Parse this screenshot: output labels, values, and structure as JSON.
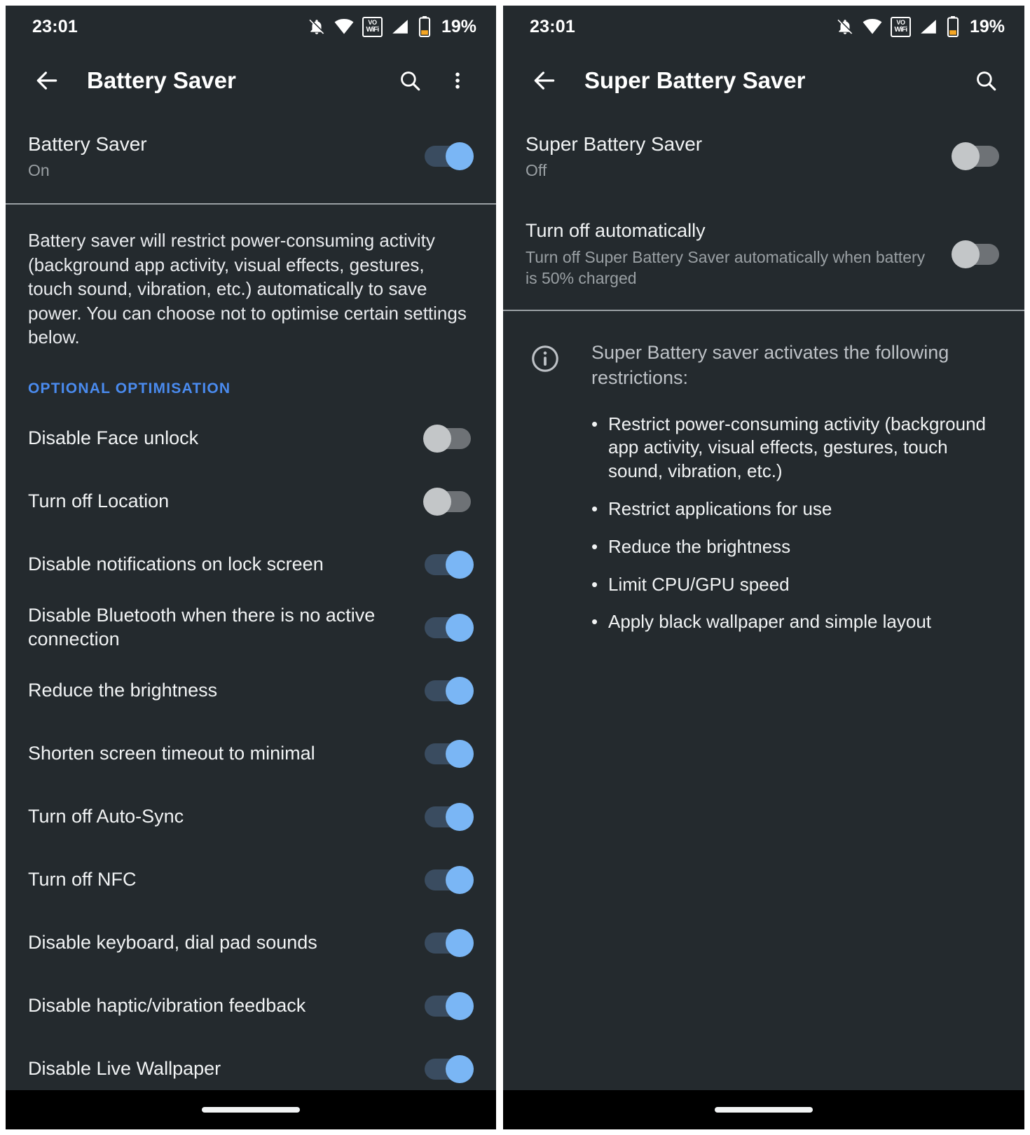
{
  "status_bar": {
    "time": "23:01",
    "battery_percent": "19%",
    "vowifi_top": "VO",
    "vowifi_bottom": "WiFi",
    "icons": [
      "notifications-off-icon",
      "wifi-icon",
      "vowifi-icon",
      "signal-icon",
      "battery-icon"
    ]
  },
  "colors": {
    "background": "#242a2e",
    "accent_blue": "#4a8bef",
    "switch_on_thumb": "#7ab6f5",
    "switch_on_track": "#3a4c60",
    "switch_off_thumb": "#c3c6c8",
    "switch_off_track": "#6e7276",
    "text_primary": "#f1f3f4",
    "text_secondary": "#9aa0a4",
    "nav_bar": "#000000"
  },
  "left_screen": {
    "app_bar": {
      "back_label": "Back",
      "title": "Battery Saver",
      "search_label": "Search",
      "overflow_label": "More options"
    },
    "master_switch": {
      "title": "Battery Saver",
      "subtitle": "On",
      "state": "on"
    },
    "description": "Battery saver will restrict power-consuming activity (background app activity, visual effects, gestures, touch sound, vibration, etc.) automatically to save power. You can choose not to optimise certain settings below.",
    "section_label": "OPTIONAL OPTIMISATION",
    "options": [
      {
        "label": "Disable Face unlock",
        "state": "off"
      },
      {
        "label": "Turn off Location",
        "state": "off"
      },
      {
        "label": "Disable notifications on lock screen",
        "state": "on"
      },
      {
        "label": "Disable Bluetooth when there is no active connection",
        "state": "on"
      },
      {
        "label": "Reduce the brightness",
        "state": "on"
      },
      {
        "label": "Shorten screen timeout to minimal",
        "state": "on"
      },
      {
        "label": "Turn off Auto-Sync",
        "state": "on"
      },
      {
        "label": "Turn off NFC",
        "state": "on"
      },
      {
        "label": "Disable keyboard, dial pad sounds",
        "state": "on"
      },
      {
        "label": "Disable haptic/vibration feedback",
        "state": "on"
      },
      {
        "label": "Disable Live Wallpaper",
        "state": "on"
      }
    ]
  },
  "right_screen": {
    "app_bar": {
      "back_label": "Back",
      "title": "Super Battery Saver",
      "search_label": "Search"
    },
    "master_switch": {
      "title": "Super Battery Saver",
      "subtitle": "Off",
      "state": "off"
    },
    "auto_off": {
      "title": "Turn off automatically",
      "subtitle": "Turn off Super Battery Saver automatically when battery is 50% charged",
      "state": "off"
    },
    "info": {
      "icon": "info-icon",
      "intro": "Super Battery saver activates the following restrictions:",
      "bullet_marker": "•",
      "bullets": [
        "Restrict power-consuming activity (background app activity, visual effects, gestures, touch sound, vibration, etc.)",
        "Restrict applications for use",
        "Reduce the brightness",
        "Limit CPU/GPU speed",
        "Apply black wallpaper and simple layout"
      ]
    }
  }
}
